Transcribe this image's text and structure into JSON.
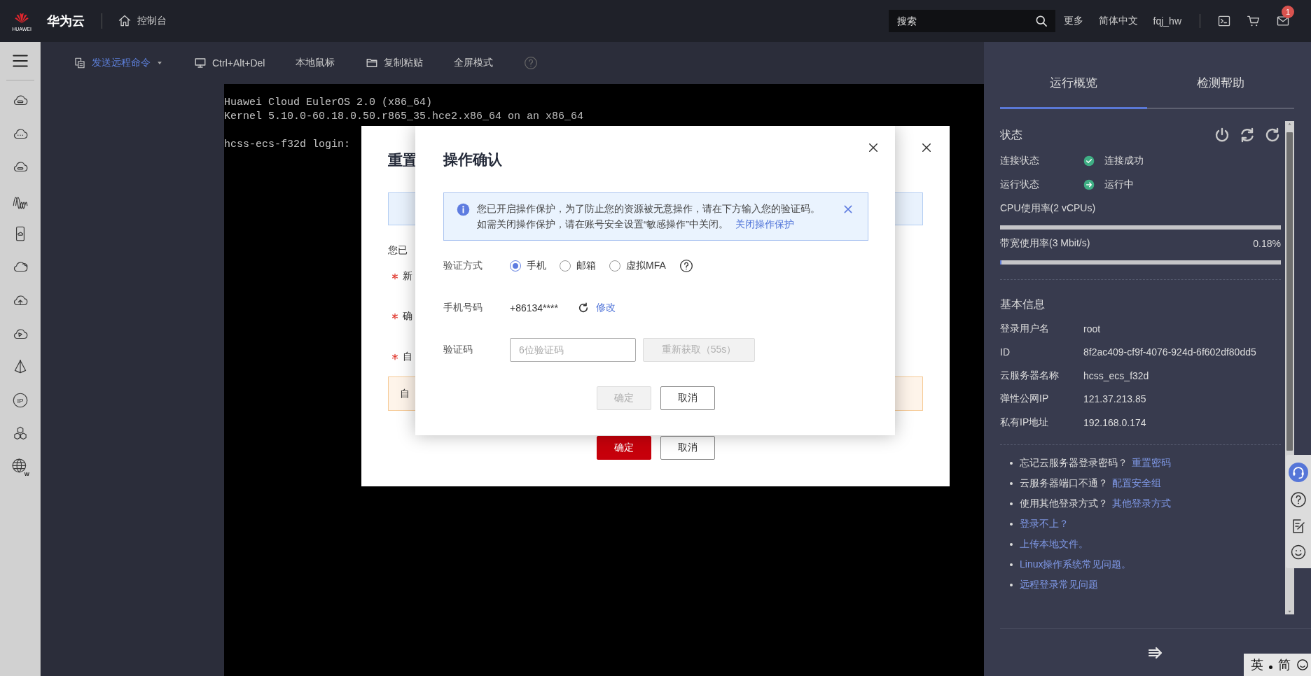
{
  "top_bar": {
    "logo_text": "HUAWEI",
    "brand": "华为云",
    "console_link": "控制台",
    "search": {
      "placeholder": "搜索"
    },
    "links": [
      "更多",
      "简体中文",
      "fqj_hw"
    ],
    "mail_badge": "1"
  },
  "sidebar": {
    "ip_label": "IP",
    "globe_label": "W"
  },
  "toolbar": {
    "items": [
      {
        "label": "发送远程命令",
        "kind": "dropdown"
      },
      {
        "label": "Ctrl+Alt+Del",
        "kind": "button"
      },
      {
        "label": "本地鼠标",
        "kind": "button"
      },
      {
        "label": "复制粘贴",
        "kind": "button"
      },
      {
        "label": "全屏模式",
        "kind": "help"
      }
    ]
  },
  "console": {
    "lines": [
      "Huawei Cloud EulerOS 2.0 (x86_64)",
      "Kernel 5.10.0-60.18.0.50.r865_35.hce2.x86_64 on an x86_64",
      "hcss-ecs-f32d login:"
    ]
  },
  "reset_dialog": {
    "title": "重置",
    "selection_text": "您已",
    "fields": [
      {
        "label": "新",
        "required": true
      },
      {
        "label": "确",
        "required": true
      },
      {
        "label": "自",
        "required": true
      }
    ],
    "warning": "自",
    "buttons": [
      {
        "label": "确定",
        "kind": "primary"
      },
      {
        "label": "取消",
        "kind": "default"
      }
    ]
  },
  "confirm_dialog": {
    "title": "操作确认",
    "notice": {
      "lines": [
        "您已开启操作保护，为了防止您的资源被无意操作，请在下方输入您的验证码。",
        "如需关闭操作保护，请在账号安全设置“敏感操作”中关闭。"
      ],
      "link": "关闭操作保护"
    },
    "method": {
      "label": "验证方式",
      "options": [
        {
          "label": "手机",
          "selected": true
        },
        {
          "label": "邮箱",
          "selected": false
        },
        {
          "label": "虚拟MFA",
          "selected": false
        }
      ]
    },
    "phone": {
      "label": "手机号码",
      "value": "+86134****",
      "link": "修改"
    },
    "code": {
      "label": "验证码",
      "placeholder": "6位验证码",
      "resend": {
        "label": "重新获取（55s）",
        "disabled": true
      }
    },
    "buttons": [
      {
        "label": "确定",
        "disabled": true
      },
      {
        "label": "取消",
        "disabled": false
      }
    ]
  },
  "side_panel": {
    "tabs": [
      {
        "label": "运行概览",
        "selected": true
      },
      {
        "label": "检测帮助",
        "selected": false
      }
    ],
    "status": {
      "title": "状态",
      "rows": [
        {
          "label": "连接状态",
          "value": "连接成功",
          "kind": "connected"
        },
        {
          "label": "运行状态",
          "value": "运行中",
          "kind": "running"
        }
      ],
      "meters": [
        {
          "label": "CPU使用率(2 vCPUs)",
          "level": 0
        },
        {
          "label": "带宽使用率(3 Mbit/s)",
          "reading": "0.18%",
          "level": 0.0018
        }
      ]
    },
    "basic_info": {
      "title": "基本信息",
      "rows": [
        {
          "label": "登录用户名",
          "value": "root"
        },
        {
          "label": "ID",
          "value": "8f2ac409-cf9f-4076-924d-6f602df80dd5"
        },
        {
          "label": "云服务器名称",
          "value": "hcss_ecs_f32d"
        },
        {
          "label": "弹性公网IP",
          "value": "121.37.213.85"
        },
        {
          "label": "私有IP地址",
          "value": "192.168.0.174"
        }
      ]
    },
    "help_links": [
      {
        "text": "忘记云服务器登录密码？",
        "link": "重置密码"
      },
      {
        "text": "云服务器端口不通？",
        "link": "配置安全组"
      },
      {
        "text": "使用其他登录方式？",
        "link": "其他登录方式"
      },
      {
        "link": "登录不上？"
      },
      {
        "link": "上传本地文件。"
      },
      {
        "link": "Linux操作系统常见问题。"
      },
      {
        "link": "远程登录常见问题"
      }
    ]
  },
  "ime_bar": {
    "items": [
      "英",
      "简"
    ]
  }
}
